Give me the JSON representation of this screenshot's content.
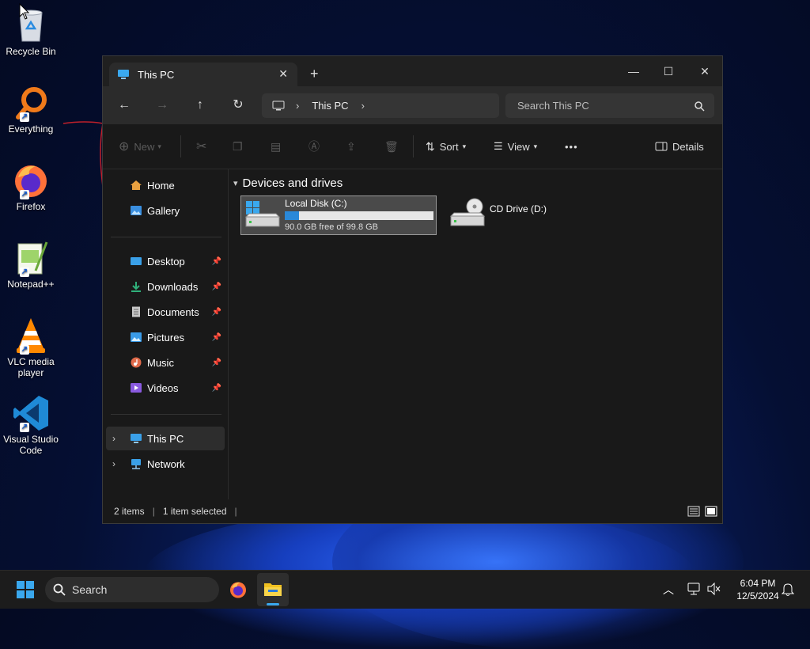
{
  "desktop": {
    "icons": [
      {
        "label": "Recycle Bin",
        "icon": "recycle-bin-icon"
      },
      {
        "label": "Everything",
        "icon": "everything-search-icon"
      },
      {
        "label": "Firefox",
        "icon": "firefox-icon"
      },
      {
        "label": "Notepad++",
        "icon": "notepad-plus-plus-icon"
      },
      {
        "label_line1": "VLC media",
        "label_line2": "player",
        "icon": "vlc-icon"
      },
      {
        "label_line1": "Visual Studio",
        "label_line2": "Code",
        "icon": "vscode-icon"
      }
    ]
  },
  "window": {
    "tab_title": "This PC",
    "new_tab_glyph": "+",
    "controls": {
      "minimize": "—",
      "maximize": "☐",
      "close": "✕"
    },
    "nav": {
      "back": "←",
      "forward": "→",
      "up": "↑",
      "refresh": "↻",
      "breadcrumb": "This PC",
      "search_placeholder": "Search This PC"
    },
    "toolbar": {
      "new_label": "New",
      "sort_label": "Sort",
      "view_label": "View",
      "more_label": "•••",
      "details_label": "Details"
    },
    "sidebar": {
      "quick": [
        {
          "label": "Home",
          "color": "#e8a040"
        },
        {
          "label": "Gallery",
          "color": "#3a8fe0"
        }
      ],
      "pinned": [
        {
          "label": "Desktop",
          "color": "#3aa0e8"
        },
        {
          "label": "Downloads",
          "color": "#2fb07a"
        },
        {
          "label": "Documents",
          "color": "#c8c8c8"
        },
        {
          "label": "Pictures",
          "color": "#3a9be8"
        },
        {
          "label": "Music",
          "color": "#e06a4a"
        },
        {
          "label": "Videos",
          "color": "#8a5ae0"
        }
      ],
      "locations": [
        {
          "label": "This PC",
          "color": "#3aa0e8"
        },
        {
          "label": "Network",
          "color": "#3aa0e8"
        }
      ]
    },
    "group_label": "Devices and drives",
    "drives": [
      {
        "name": "Local Disk (C:)",
        "free_text": "90.0 GB free of 99.8 GB",
        "used_fraction": 0.098
      },
      {
        "name": "CD Drive (D:)"
      }
    ],
    "status": {
      "items": "2 items",
      "selected": "1 item selected"
    }
  },
  "taskbar": {
    "search_label": "Search",
    "time": "6:04 PM",
    "date": "12/5/2024"
  }
}
